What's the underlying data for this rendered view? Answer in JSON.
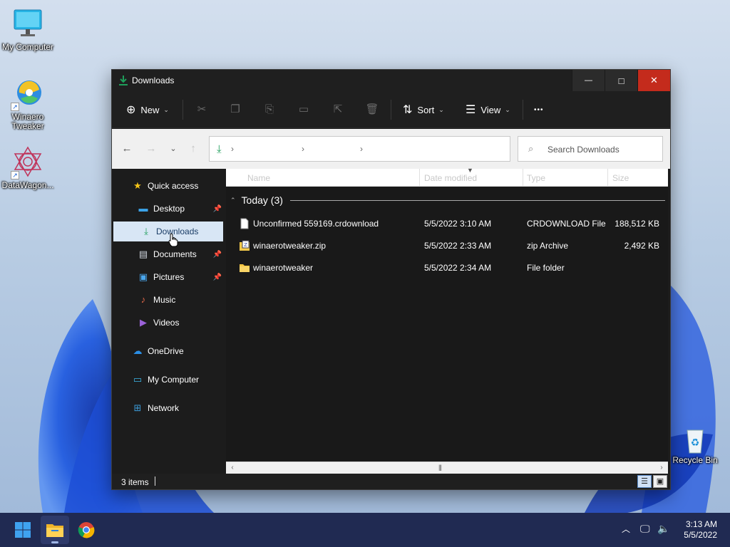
{
  "desktop": {
    "icons": [
      {
        "label": "My Computer",
        "icon": "monitor-icon"
      },
      {
        "label": "Winaero Tweaker",
        "icon": "winaero-tweaker-icon"
      },
      {
        "label": "DataWagon...",
        "icon": "datawagon-icon"
      },
      {
        "label": "Recycle Bin",
        "icon": "recycle-bin-icon"
      }
    ]
  },
  "window": {
    "title": "Downloads",
    "controls": {
      "minimize": "—",
      "maximize": "□",
      "close": "✕"
    }
  },
  "commandbar": {
    "new_label": "New",
    "sort_label": "Sort",
    "view_label": "View",
    "more_label": "•••"
  },
  "navbar": {
    "search_placeholder": "Search Downloads"
  },
  "navpane": {
    "items": [
      {
        "label": "Quick access",
        "icon": "star-icon"
      },
      {
        "label": "Desktop",
        "icon": "desktop-folder-icon",
        "pinned": true
      },
      {
        "label": "Downloads",
        "icon": "download-icon",
        "selected": true
      },
      {
        "label": "Documents",
        "icon": "documents-icon",
        "pinned": true
      },
      {
        "label": "Pictures",
        "icon": "pictures-icon",
        "pinned": true
      },
      {
        "label": "Music",
        "icon": "music-icon"
      },
      {
        "label": "Videos",
        "icon": "videos-icon"
      },
      {
        "label": "OneDrive",
        "icon": "cloud-icon"
      },
      {
        "label": "My Computer",
        "icon": "monitor-icon"
      },
      {
        "label": "Network",
        "icon": "network-icon"
      }
    ]
  },
  "content": {
    "columns": [
      "Name",
      "Date modified",
      "Type",
      "Size"
    ],
    "group_label": "Today (3)",
    "files": [
      {
        "name": "Unconfirmed 559169.crdownload",
        "date": "5/5/2022 3:10 AM",
        "type": "CRDOWNLOAD File",
        "size": "188,512 KB",
        "icon": "file-icon"
      },
      {
        "name": "winaerotweaker.zip",
        "date": "5/5/2022 2:33 AM",
        "type": "zip Archive",
        "size": "2,492 KB",
        "icon": "zip-icon"
      },
      {
        "name": "winaerotweaker",
        "date": "5/5/2022 2:34 AM",
        "type": "File folder",
        "size": "",
        "icon": "folder-icon"
      }
    ]
  },
  "status": {
    "items_count": "3 items"
  },
  "taskbar": {
    "apps": [
      "start-icon",
      "file-explorer-icon",
      "chrome-icon"
    ],
    "time": "3:13 AM",
    "date": "5/5/2022"
  },
  "colors": {
    "accent_download": "#1e9e5a",
    "close_red": "#c42b1c",
    "taskbar": "#202a52",
    "selection": "#d8e6f5"
  }
}
